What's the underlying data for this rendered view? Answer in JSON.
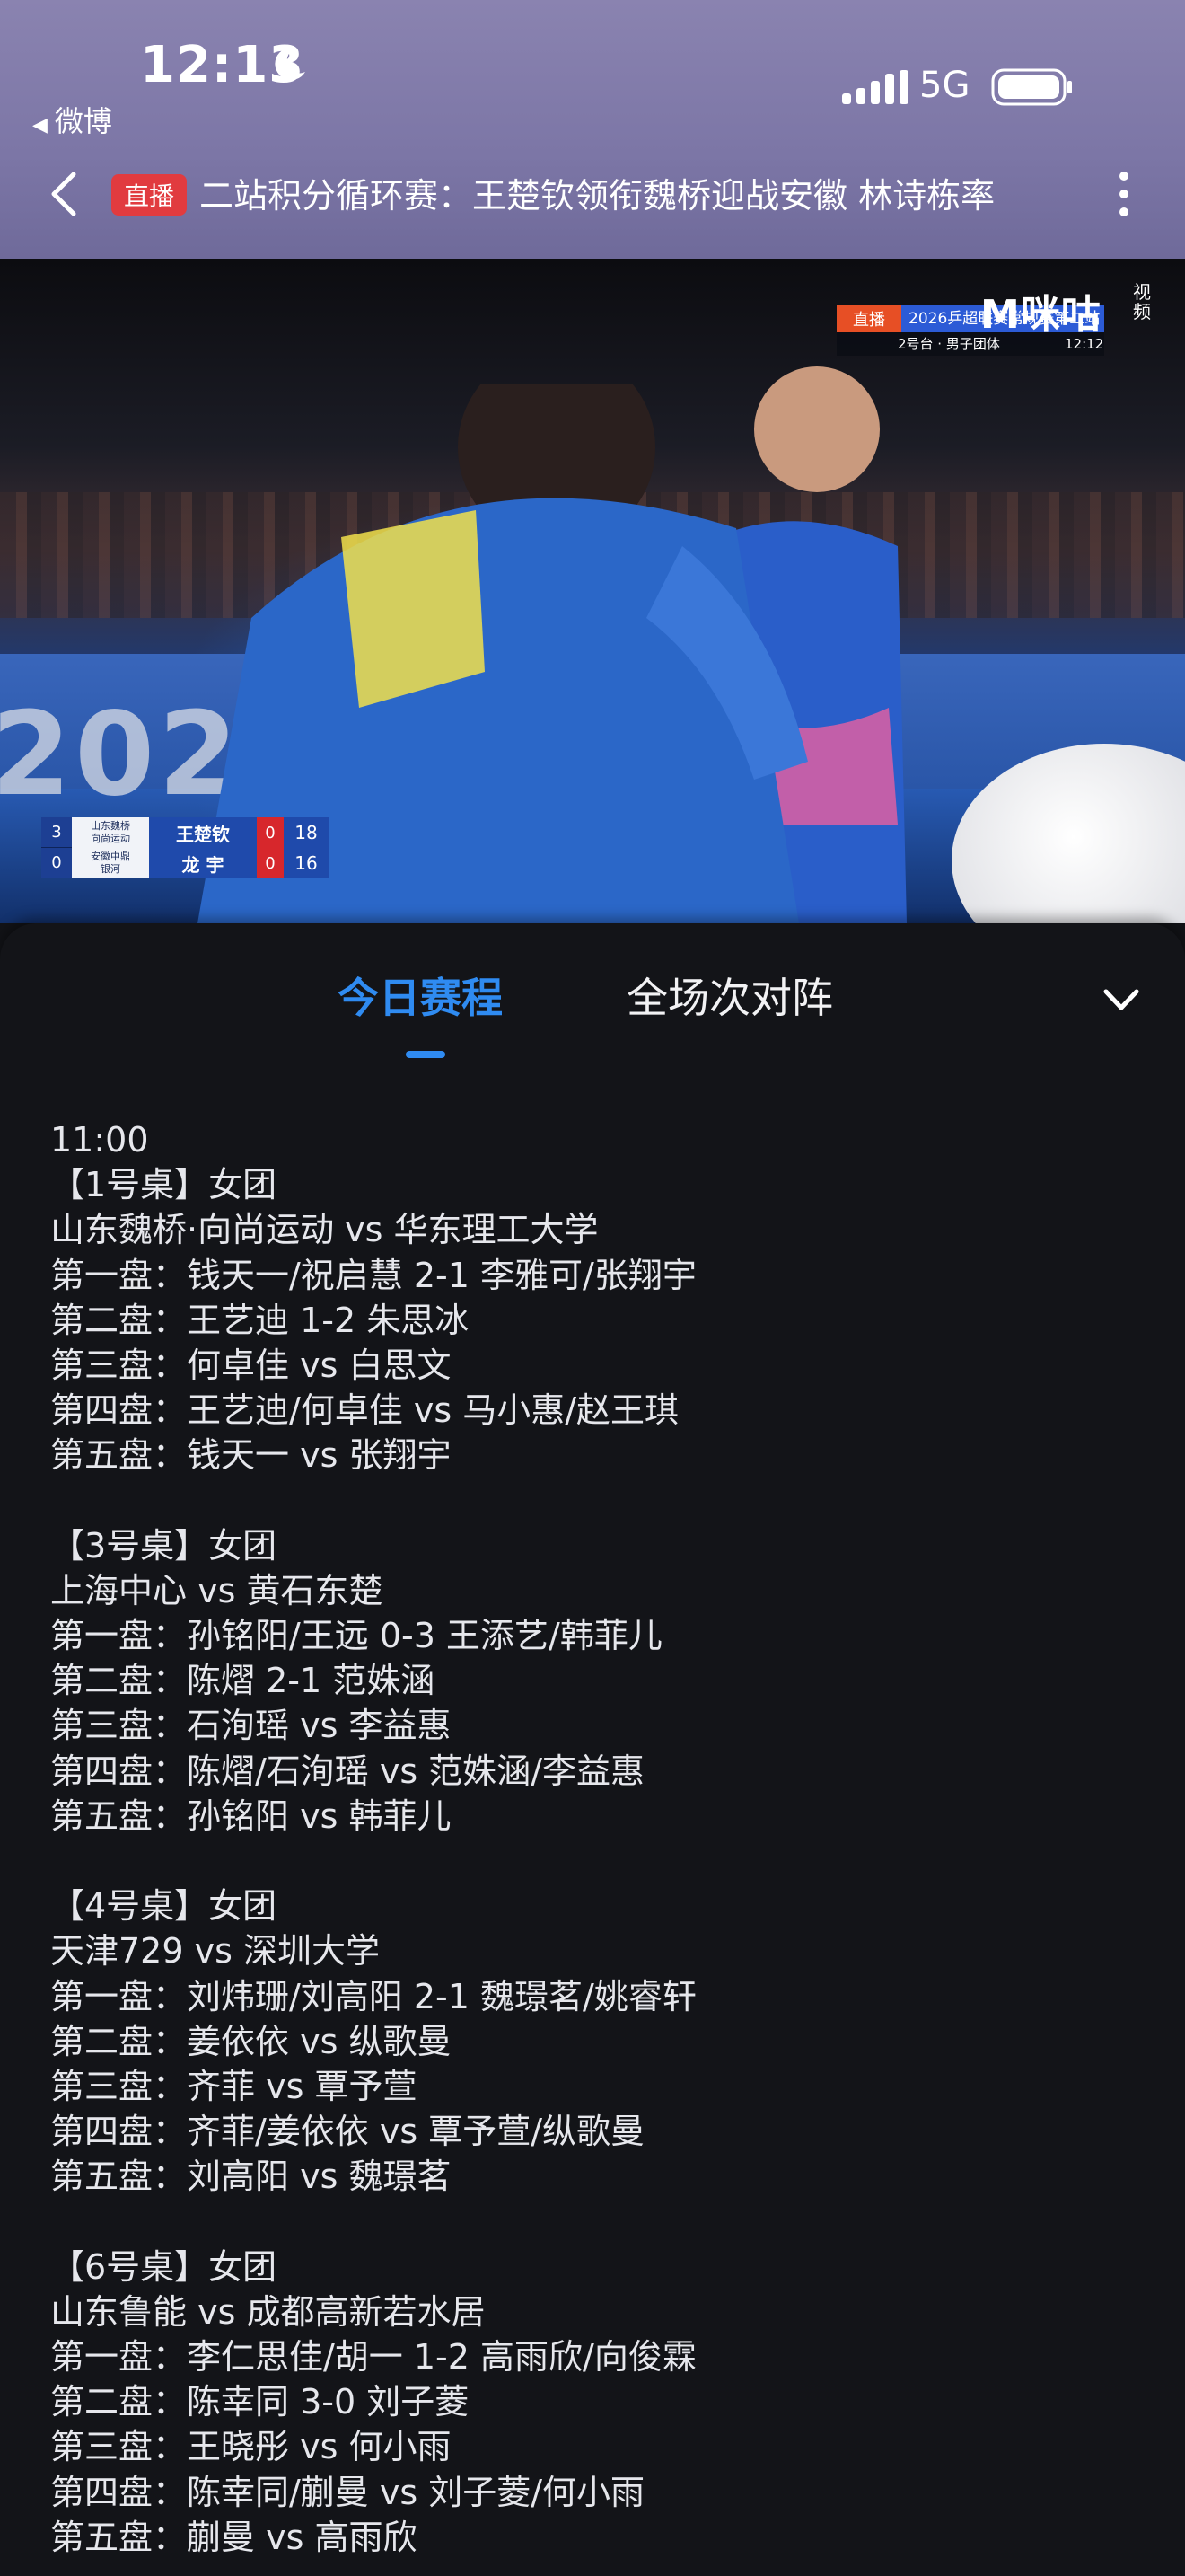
{
  "status_bar": {
    "time": "12:13",
    "back_app": "微博",
    "network": "5G",
    "icons": [
      "moon-icon",
      "signal-icon",
      "battery-icon"
    ]
  },
  "nav": {
    "live_badge": "直播",
    "title": "二站积分循环赛：王楚钦领衔魏桥迎战安徽 林诗栋率"
  },
  "video": {
    "bug_live": "直播",
    "bug_title": "2026乒超联赛常规赛第二站",
    "bug_sub": "2号台 · 男子团体",
    "bug_time": "12:12",
    "brand": "M咪咕",
    "brand_sub": "视频",
    "year": "2026",
    "scoreboard": [
      {
        "sets": "3",
        "team_line1": "山东魏桥",
        "team_line2": "向尚运动",
        "player": "王楚钦",
        "game": "0",
        "points": "18"
      },
      {
        "sets": "0",
        "team_line1": "安徽中鼎",
        "team_line2": "银河",
        "player": "龙 宇",
        "game": "0",
        "points": "16"
      }
    ]
  },
  "tabs": {
    "today": "今日赛程",
    "lineup": "全场次对阵"
  },
  "schedule": {
    "time": "11:00",
    "tables": [
      {
        "header": "【1号桌】女团",
        "matchup": "山东魏桥·向尚运动 vs 华东理工大学",
        "games": [
          "第一盘：钱天一/祝启慧 2-1 李雅可/张翔宇",
          "第二盘：王艺迪 1-2 朱思冰",
          "第三盘：何卓佳 vs 白思文",
          "第四盘：王艺迪/何卓佳 vs 马小惠/赵王琪",
          "第五盘：钱天一 vs 张翔宇"
        ]
      },
      {
        "header": "【3号桌】女团",
        "matchup": "上海中心 vs 黄石东楚",
        "games": [
          "第一盘：孙铭阳/王远 0-3 王添艺/韩菲儿",
          "第二盘：陈熠 2-1 范姝涵",
          "第三盘：石洵瑶 vs 李益惠",
          "第四盘：陈熠/石洵瑶 vs 范姝涵/李益惠",
          "第五盘：孙铭阳 vs 韩菲儿"
        ]
      },
      {
        "header": "【4号桌】女团",
        "matchup": "天津729 vs 深圳大学",
        "games": [
          "第一盘：刘炜珊/刘高阳 2-1 魏璟茗/姚睿轩",
          "第二盘：姜依依 vs 纵歌曼",
          "第三盘：齐菲 vs 覃予萱",
          "第四盘：齐菲/姜依依 vs 覃予萱/纵歌曼",
          "第五盘：刘高阳 vs 魏璟茗"
        ]
      },
      {
        "header": "【6号桌】女团",
        "matchup": "山东鲁能 vs 成都高新若水居",
        "games": [
          "第一盘：李仁思佳/胡一 1-2 高雨欣/向俊霖",
          "第二盘：陈幸同 3-0 刘子菱",
          "第三盘：王晓彤 vs 何小雨",
          "第四盘：陈幸同/蒯曼 vs 刘子菱/何小雨",
          "第五盘：蒯曼 vs 高雨欣"
        ]
      }
    ]
  },
  "colors": {
    "header_bg": "#7c76a6",
    "accent_blue": "#2f8bf1",
    "live_red": "#e13b3f",
    "sheet_bg": "#131418"
  }
}
